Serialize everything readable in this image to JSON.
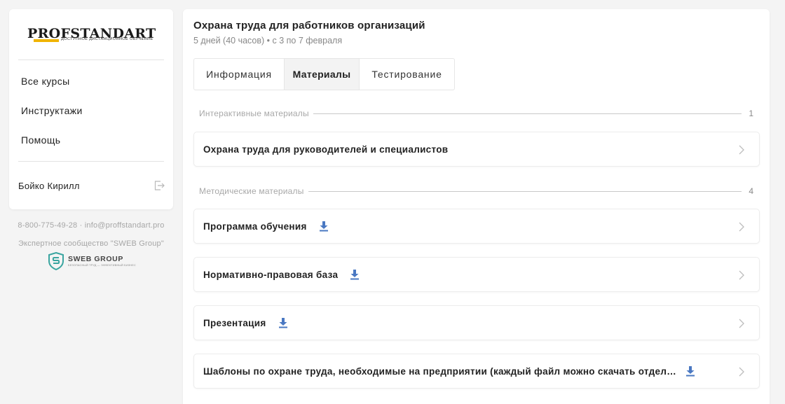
{
  "brand": {
    "name": "PROFSTANDART",
    "tagline": "ДОСТУПНОЕ ДИСТАНЦИОННОЕ ОБУЧЕНИЕ",
    "accent": "#f0b400"
  },
  "sidebar": {
    "nav": [
      {
        "label": "Все курсы"
      },
      {
        "label": "Инструктажи"
      },
      {
        "label": "Помощь"
      }
    ],
    "user_name": "Бойко Кирилл"
  },
  "contacts": {
    "phone": "8-800-775-49-28",
    "separator": "·",
    "email": "info@proffstandart.pro",
    "community": "Экспертное сообщество \"SWEB Group\"",
    "partner_logo": "SWEB GROUP",
    "partner_tagline": "БЕЗОПАСНЫЙ ТРУД — ЭФФЕКТИВНЫЙ БИЗНЕС"
  },
  "course": {
    "title": "Охрана труда для работников организаций",
    "subtitle": "5 дней (40 часов) • с 3 по 7 февраля"
  },
  "tabs": [
    {
      "label": "Информация",
      "active": false
    },
    {
      "label": "Материалы",
      "active": true
    },
    {
      "label": "Тестирование",
      "active": false
    }
  ],
  "sections": [
    {
      "label": "Интерактивные материалы",
      "count": "1",
      "items": [
        {
          "label": "Охрана труда для руководителей и специалистов",
          "download": false
        }
      ]
    },
    {
      "label": "Методические материалы",
      "count": "4",
      "items": [
        {
          "label": "Программа обучения",
          "download": true
        },
        {
          "label": "Нормативно-правовая база",
          "download": true
        },
        {
          "label": "Презентация",
          "download": true
        },
        {
          "label": "Шаблоны по охране труда, необходимые на предприятии (каждый файл можно скачать отдельно)",
          "download": true
        }
      ]
    }
  ],
  "colors": {
    "download_icon": "#4a78c2",
    "sweb_icon": "#3aa5a0"
  },
  "icons": {
    "logout": "logout-icon",
    "download": "download-icon",
    "chevron": "chevron-right-icon"
  }
}
